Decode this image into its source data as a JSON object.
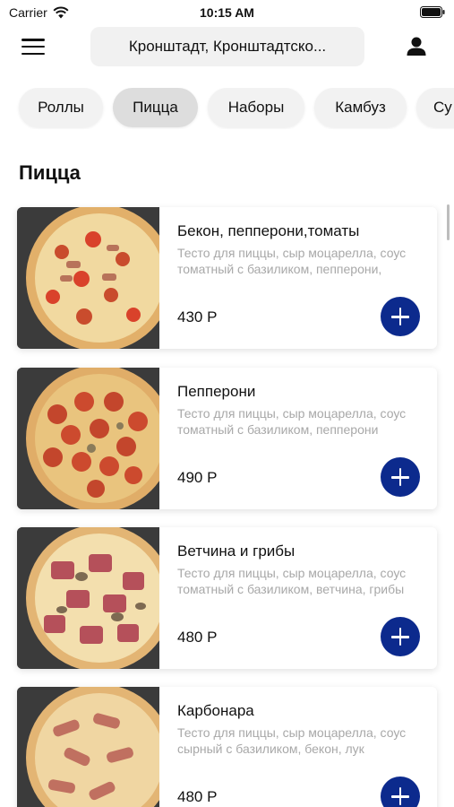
{
  "status_bar": {
    "carrier": "Carrier",
    "time": "10:15 AM",
    "icons": [
      "wifi-icon",
      "battery-icon"
    ]
  },
  "header": {
    "address": "Кронштадт, Кронштадтско...",
    "icons": [
      "menu-icon",
      "profile-icon"
    ]
  },
  "categories": [
    {
      "label": "Роллы",
      "active": false
    },
    {
      "label": "Пицца",
      "active": true
    },
    {
      "label": "Наборы",
      "active": false
    },
    {
      "label": "Камбуз",
      "active": false
    },
    {
      "label": "Су",
      "active": false
    }
  ],
  "section": {
    "title": "Пицца"
  },
  "products": [
    {
      "name": "Бекон, пепперони,томаты",
      "description": "Тесто для пиццы, сыр моцарелла, соус томатный с базиликом, пепперони, бекон, томаты",
      "price": "430 Р",
      "topping": "tomato-pepperoni"
    },
    {
      "name": "Пепперони",
      "description": "Тесто для пиццы, сыр моцарелла, соус томатный с базиликом, пепперони",
      "price": "490 Р",
      "topping": "pepperoni"
    },
    {
      "name": "Ветчина и грибы",
      "description": "Тесто для пиццы, сыр моцарелла, соус томатный с базиликом, ветчина, грибы",
      "price": "480 Р",
      "topping": "ham-mushroom"
    },
    {
      "name": "Карбонара",
      "description": "Тесто для пиццы, сыр моцарелла, соус сырный с базиликом, бекон, лук",
      "price": "480 Р",
      "topping": "bacon"
    }
  ],
  "colors": {
    "accent": "#0c2a8d",
    "pill_bg": "#f2f2f2",
    "pill_active_bg": "#dddddd",
    "muted_text": "#a8a8a8"
  }
}
